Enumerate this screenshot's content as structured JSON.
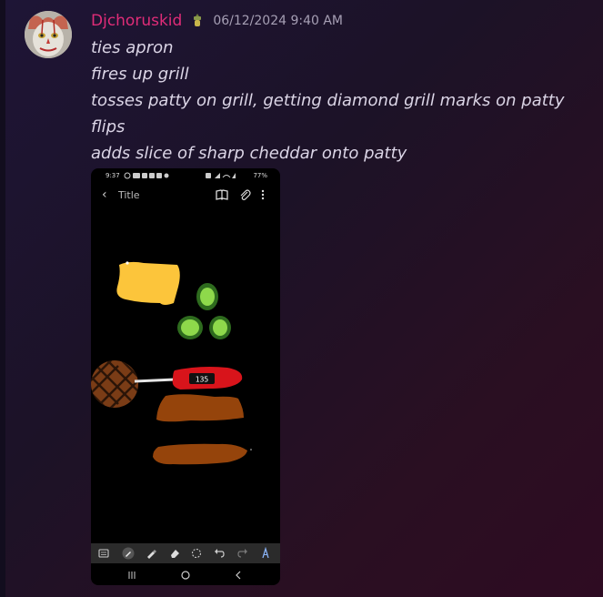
{
  "message": {
    "username": "Djchoruskid",
    "timestamp": "06/12/2024 9:40 AM",
    "lines": [
      "ties apron",
      "fires up grill",
      "tosses patty on grill, getting diamond grill marks on patty",
      "flips",
      "adds slice of sharp cheddar onto patty"
    ]
  },
  "phone": {
    "status_time": "9:37",
    "battery": "77%",
    "doc_title": "Title",
    "thermometer_reading": "135"
  },
  "colors": {
    "username": "#e02c78",
    "cheese": "#fcc53b",
    "pickle": "#8ed94b",
    "patty": "#95440b",
    "thermometer": "#d8141b"
  },
  "icons": {
    "back": "chevron-left-icon",
    "reader": "book-icon",
    "attach": "paperclip-icon",
    "more": "more-vertical-icon"
  }
}
